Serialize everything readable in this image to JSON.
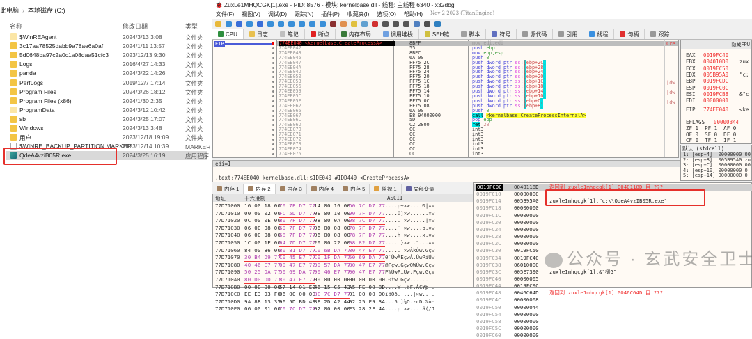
{
  "explorer": {
    "breadcrumb": [
      "此电脑",
      "本地磁盘 (C:)"
    ],
    "columns": {
      "name": "名称",
      "date": "修改日期",
      "type": "类型"
    },
    "files": [
      {
        "name": "$WinREAgent",
        "date": "2024/3/13 3:08",
        "type": "文件夹",
        "icon": "folder-light"
      },
      {
        "name": "3c17aa78525dabb9a78ae6a0af",
        "date": "2024/1/11 13:57",
        "type": "文件夹",
        "icon": "folder"
      },
      {
        "name": "5d0648ba97c2a0c1a08daa51cfc3",
        "date": "2023/12/13 9:30",
        "type": "文件夹",
        "icon": "folder"
      },
      {
        "name": "Logs",
        "date": "2016/4/27 14:33",
        "type": "文件夹",
        "icon": "folder"
      },
      {
        "name": "panda",
        "date": "2024/3/22 14:26",
        "type": "文件夹",
        "icon": "folder"
      },
      {
        "name": "PerfLogs",
        "date": "2019/12/7 17:14",
        "type": "文件夹",
        "icon": "folder"
      },
      {
        "name": "Program Files",
        "date": "2024/3/26 18:12",
        "type": "文件夹",
        "icon": "folder"
      },
      {
        "name": "Program Files (x86)",
        "date": "2024/1/30 2:35",
        "type": "文件夹",
        "icon": "folder"
      },
      {
        "name": "ProgramData",
        "date": "2024/3/12 10:42",
        "type": "文件夹",
        "icon": "folder-light"
      },
      {
        "name": "sb",
        "date": "2024/3/25 17:07",
        "type": "文件夹",
        "icon": "folder"
      },
      {
        "name": "Windows",
        "date": "2024/3/13 3:48",
        "type": "文件夹",
        "icon": "folder"
      },
      {
        "name": "用户",
        "date": "2023/12/18 19:09",
        "type": "文件夹",
        "icon": "folder"
      },
      {
        "name": "$WINRE_BACKUP_PARTITION.MARKER",
        "date": "2023/12/14 10:39",
        "type": "MARKER 文",
        "icon": "file"
      },
      {
        "name": "QdeA4vziB05R.exe",
        "date": "2024/3/25 16:19",
        "type": "应用程序",
        "icon": "exe",
        "selected": true
      }
    ]
  },
  "debugger": {
    "title": "ZuxLe1MHQCGK[1].exe - PID: 8576 - 模块: kernelbase.dll - 线程: 主线程 6340 - x32dbg",
    "menu": [
      "文件(F)",
      "视图(V)",
      "调试(D)",
      "跟踪(N)",
      "插件(P)",
      "收藏夹(I)",
      "选项(O)",
      "帮助(H)"
    ],
    "build": "Nov 2 2023 (TitanEngine)",
    "tabs": [
      "CPU",
      "日志",
      "笔记",
      "断点",
      "内存布局",
      "调用堆栈",
      "SEH链",
      "脚本",
      "符号",
      "源代码",
      "引用",
      "线程",
      "句柄",
      "跟踪"
    ],
    "eip_label": "EIP",
    "disasm": [
      {
        "addr": "774EE040 <kernelbase.CreateProcessA>",
        "bytes": "8BFF",
        "asm": "mov edi,edi",
        "current": true
      },
      {
        "addr": "774EE042",
        "bytes": "55",
        "asm": "push ebp"
      },
      {
        "addr": "774EE043",
        "bytes": "8BEC",
        "asm": "mov ebp,esp"
      },
      {
        "addr": "774EE045",
        "bytes": "6A 00",
        "asm": "push 0"
      },
      {
        "addr": "774EE047",
        "bytes": "FF75 2C",
        "asm": "push dword ptr ss:[ebp+2C]"
      },
      {
        "addr": "774EE04A",
        "bytes": "FF75 28",
        "asm": "push dword ptr ss:[ebp+28]"
      },
      {
        "addr": "774EE04D",
        "bytes": "FF75 24",
        "asm": "push dword ptr ss:[ebp+24]"
      },
      {
        "addr": "774EE050",
        "bytes": "FF75 20",
        "asm": "push dword ptr ss:[ebp+20]"
      },
      {
        "addr": "774EE053",
        "bytes": "FF75 1C",
        "asm": "push dword ptr ss:[ebp+1C]"
      },
      {
        "addr": "774EE056",
        "bytes": "FF75 18",
        "asm": "push dword ptr ss:[ebp+18]"
      },
      {
        "addr": "774EE059",
        "bytes": "FF75 14",
        "asm": "push dword ptr ss:[ebp+14]"
      },
      {
        "addr": "774EE05C",
        "bytes": "FF75 10",
        "asm": "push dword ptr ss:[ebp+10]"
      },
      {
        "addr": "774EE05F",
        "bytes": "FF75 0C",
        "asm": "push dword ptr ss:[ebp+C]"
      },
      {
        "addr": "774EE062",
        "bytes": "FF75 08",
        "asm": "push dword ptr ss:[ebp+8]"
      },
      {
        "addr": "774EE065",
        "bytes": "6A 00",
        "asm": "push 0"
      },
      {
        "addr": "774EE067",
        "bytes": "E8 94000000",
        "asm": "call <kernelbase.CreateProcessInternalA>"
      },
      {
        "addr": "774EE06C",
        "bytes": "5D",
        "asm": "pop ebp"
      },
      {
        "addr": "774EE06D",
        "bytes": "C2 2800",
        "asm": "ret 28"
      },
      {
        "addr": "774EE070",
        "bytes": "CC",
        "asm": "int3"
      },
      {
        "addr": "774EE071",
        "bytes": "CC",
        "asm": "int3"
      },
      {
        "addr": "774EE072",
        "bytes": "CC",
        "asm": "int3"
      },
      {
        "addr": "774EE073",
        "bytes": "CC",
        "asm": "int3"
      },
      {
        "addr": "774EE074",
        "bytes": "CC",
        "asm": "int3"
      },
      {
        "addr": "774EE075",
        "bytes": "CC",
        "asm": "int3"
      }
    ],
    "comments": [
      "Cre",
      "[dw",
      "[dw",
      "[dw"
    ],
    "registers": {
      "header": "隐藏FPU",
      "gp": [
        {
          "name": "EAX",
          "value": "0019FC40",
          "comment": ""
        },
        {
          "name": "EBX",
          "value": "004010D0",
          "comment": "zux"
        },
        {
          "name": "ECX",
          "value": "0019FC50",
          "comment": ""
        },
        {
          "name": "EDX",
          "value": "005B95A0",
          "comment": "\"c:"
        },
        {
          "name": "EBP",
          "value": "0019FCDC",
          "comment": ""
        },
        {
          "name": "ESP",
          "value": "0019FC0C",
          "comment": ""
        },
        {
          "name": "ESI",
          "value": "0019FCB8",
          "comment": "&\"c"
        },
        {
          "name": "EDI",
          "value": "00000001",
          "comment": ""
        }
      ],
      "eip": {
        "name": "EIP",
        "value": "774EE040",
        "comment": "<ke"
      },
      "eflags": {
        "name": "EFLAGS",
        "value": "00000344"
      },
      "flags": [
        "ZF 1  PF 1  AF 0",
        "OF 0  SF 0  DF 0",
        "CF 0  TF 1  IF 1"
      ]
    },
    "args": {
      "header": "默认 (stdcall)",
      "rows": [
        "1: [esp+4]  00000000 00",
        "2: [esp+8]  005B95A0 zu",
        "3: [esp+C]  00000000 00",
        "4: [esp+10] 00000000 0",
        "5: [esp+14] 00000000 0"
      ]
    },
    "info": {
      "edi": "edi=1",
      "section": ".text:774EE040 kernelbase.dll:$1DE040 #1DD440 <CreateProcessA>"
    },
    "mem_tabs": [
      "内存 1",
      "内存 2",
      "内存 3",
      "内存 4",
      "内存 5",
      "监视 1",
      "局部变量"
    ],
    "dump": {
      "headers": {
        "addr": "地址",
        "hex": "十六进制",
        "ascii": "ASCII"
      },
      "rows": [
        {
          "addr": "77D71000",
          "hex": [
            "16 00 18 00",
            "70 7E D7 77",
            "14 00 16 00",
            "D0 7C D7 77"
          ],
          "ascii": "....p~×w....Ð|×w"
        },
        {
          "addr": "77D71010",
          "hex": [
            "00 00 02 00",
            "FC 5D D7 77",
            "0E 00 10 00",
            "90 7F D7 77"
          ],
          "ascii": "....ü]×w......×w"
        },
        {
          "addr": "77D71020",
          "hex": [
            "0C 00 0E 00",
            "80 7F D7 77",
            "08 00 0A 00",
            "08 7C D7 77"
          ],
          "ascii": "......×w.....|×w"
        },
        {
          "addr": "77D71030",
          "hex": [
            "06 00 08 00",
            "60 7F D7 77",
            "06 00 08 00",
            "70 7F D7 77"
          ],
          "ascii": "....`.×w....p.×w"
        },
        {
          "addr": "77D71040",
          "hex": [
            "06 00 08 00",
            "68 7F D7 77",
            "06 00 08 00",
            "78 7F D7 77"
          ],
          "ascii": "....h.×w....x.×w"
        },
        {
          "addr": "77D71050",
          "hex": [
            "1C 00 1E 00",
            "04 7D D7 77",
            "20 00 22 00",
            "08 82 D7 77"
          ],
          "ascii": ".....}×w .\"...×w"
        },
        {
          "addr": "77D71060",
          "hex": [
            "84 00 86 00",
            "80 81 D7 77",
            "C0 6B DA 77",
            "80 47 E7 77"
          ],
          "ascii": "......×wÀkÚw.Gçw"
        },
        {
          "addr": "77D71070",
          "hex": [
            "30 B4 D9 77",
            "C0 45 E7 77",
            "C0 1F DA 77",
            "50 69 DA 77"
          ],
          "ascii": "0´ÙwÀEçwÀ.ÚwPiÚw"
        },
        {
          "addr": "77D71080",
          "hex": [
            "40 46 E7 77",
            "00 47 E7 77",
            "30 57 DA 77",
            "80 47 E7 77"
          ],
          "ascii": "@Fçw.Gçw0WÚw.Gçw"
        },
        {
          "addr": "77D71090",
          "hex": [
            "50 25 DA 77",
            "50 69 DA 77",
            "90 46 E7 77",
            "00 47 E7 77"
          ],
          "ascii": "P%ÚwPiÚw.Fçw.Gçw"
        },
        {
          "addr": "77D710A0",
          "hex": [
            "80 D0 DD 77",
            "80 47 E7 77",
            "00 00 00 00",
            "00 00 00 00"
          ],
          "ascii": ".ÐÝw.Gçw........"
        },
        {
          "addr": "77D710B0",
          "hex": [
            "00 00 00 00",
            "57 14 01 E2",
            "46 15 C5 43",
            "A5 FE 00 8D"
          ],
          "ascii": "....W..âF.ÅC¥þ.."
        },
        {
          "addr": "77D710C0",
          "hex": [
            "EE E3 D3 F0",
            "06 00 00 00",
            "8C 7C D7 77",
            "01 00 00 00"
          ],
          "ascii": "îãÓð.....|×w...."
        },
        {
          "addr": "77D710D0",
          "hex": [
            "9A 8B 13 35",
            "96 5D BD 4F",
            "8E 2D A2 44",
            "02 25 F9 3A"
          ],
          "ascii": "...5.]½O.-¢D.%ù:"
        },
        {
          "addr": "77D710E0",
          "hex": [
            "06 00 01 00",
            "70 7C D7 77",
            "02 00 00 00",
            "E3 28 2F 4A"
          ],
          "ascii": "....p|×w....ã(/J"
        }
      ]
    },
    "stack": [
      {
        "addr": "0019FC0C",
        "value": "0040118D",
        "comment": "返回到 zuxle1mhqcgk[1].0040118D 自 ???",
        "ret": true,
        "current": true
      },
      {
        "addr": "0019FC10",
        "value": "00000000",
        "comment": ""
      },
      {
        "addr": "0019FC14",
        "value": "005B95A0",
        "comment": "zuxle1mhqcgk[1].\"c:\\\\QdeA4vzIB05R.exe\""
      },
      {
        "addr": "0019FC18",
        "value": "00000000",
        "comment": ""
      },
      {
        "addr": "0019FC1C",
        "value": "00000000",
        "comment": ""
      },
      {
        "addr": "0019FC20",
        "value": "00000000",
        "comment": ""
      },
      {
        "addr": "0019FC24",
        "value": "00000000",
        "comment": ""
      },
      {
        "addr": "0019FC28",
        "value": "00000000",
        "comment": ""
      },
      {
        "addr": "0019FC2C",
        "value": "00000000",
        "comment": ""
      },
      {
        "addr": "0019FC30",
        "value": "0019FC50",
        "comment": ""
      },
      {
        "addr": "0019FC34",
        "value": "0019FC40",
        "comment": ""
      },
      {
        "addr": "0019FC38",
        "value": "06010000",
        "comment": ""
      },
      {
        "addr": "0019FC3C",
        "value": "005E7390",
        "comment": "zuxle1mhqcgk[1].&\"槌G\""
      },
      {
        "addr": "0019FC40",
        "value": "00000005",
        "comment": ""
      },
      {
        "addr": "0019FC44",
        "value": "0019FC9C",
        "comment": ""
      },
      {
        "addr": "0019FC48",
        "value": "0046C64D",
        "comment": "返回到 zuxle1mhqcgk[1].0046C64D 自 ???",
        "ret": true
      },
      {
        "addr": "0019FC4C",
        "value": "00000008",
        "comment": ""
      },
      {
        "addr": "0019FC50",
        "value": "00000044",
        "comment": ""
      },
      {
        "addr": "0019FC54",
        "value": "00000000",
        "comment": ""
      },
      {
        "addr": "0019FC58",
        "value": "00000000",
        "comment": ""
      },
      {
        "addr": "0019FC5C",
        "value": "00000000",
        "comment": ""
      },
      {
        "addr": "0019FC60",
        "value": "00000000",
        "comment": ""
      }
    ]
  },
  "watermark": "公众号 · 玄武安全卫士",
  "colors": {
    "highlight_box": "#e5302b",
    "eip_blue": "#4b5bd8",
    "register_red": "#f03030",
    "panel_bg": "#fffaf4"
  }
}
